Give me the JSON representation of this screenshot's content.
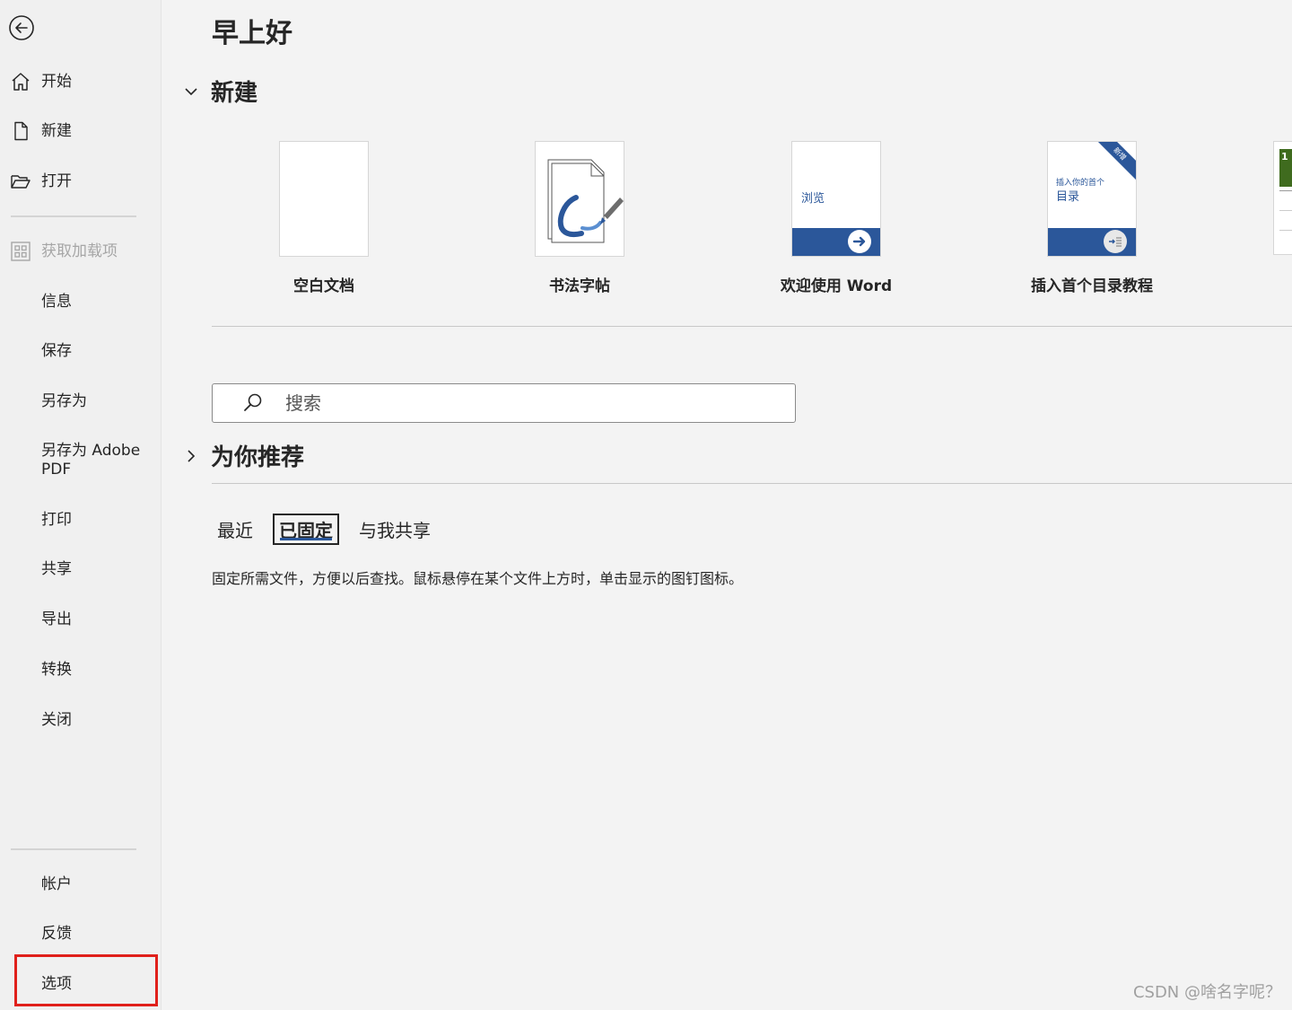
{
  "sidebar": {
    "items": [
      {
        "label": "开始",
        "icon": "home-icon"
      },
      {
        "label": "新建",
        "icon": "new-document-icon"
      },
      {
        "label": "打开",
        "icon": "open-folder-icon"
      },
      {
        "label": "获取加载项",
        "icon": "add-ins-grid-icon",
        "disabled": true
      },
      {
        "label": "信息"
      },
      {
        "label": "保存"
      },
      {
        "label": "另存为"
      },
      {
        "label": "另存为 Adobe PDF"
      },
      {
        "label": "打印"
      },
      {
        "label": "共享"
      },
      {
        "label": "导出"
      },
      {
        "label": "转换"
      },
      {
        "label": "关闭"
      }
    ],
    "bottom_items": [
      {
        "label": "帐户"
      },
      {
        "label": "反馈"
      },
      {
        "label": "选项",
        "highlighted": true
      }
    ],
    "highlight_color": "#e0201b"
  },
  "main": {
    "greeting": "早上好",
    "new_section": {
      "title": "新建",
      "templates": [
        {
          "label": "空白文档"
        },
        {
          "label": "书法字帖"
        },
        {
          "label": "欢迎使用 Word",
          "thumb_text": "浏览"
        },
        {
          "label": "插入首个目录教程",
          "thumb_text_small": "插入你的首个",
          "thumb_text_large": "目录",
          "ribbon": "新增"
        }
      ],
      "partial_template_number": "1"
    },
    "search": {
      "placeholder": "搜索"
    },
    "recommended": {
      "title": "为你推荐"
    },
    "tabs": [
      {
        "label": "最近"
      },
      {
        "label": "已固定",
        "active": true
      },
      {
        "label": "与我共享"
      }
    ],
    "pinned_hint": "固定所需文件，方便以后查找。鼠标悬停在某个文件上方时，单击显示的图钉图标。"
  },
  "watermark": "CSDN @啥名字呢？",
  "colors": {
    "accent": "#2b579a",
    "background": "#f3f3f3",
    "sidebar": "#f0f0f0"
  }
}
